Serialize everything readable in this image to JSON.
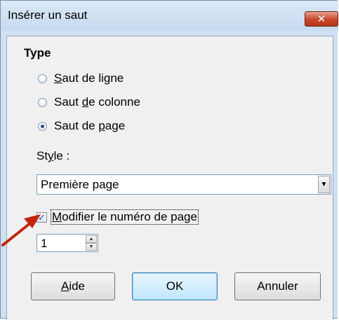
{
  "dialog": {
    "title": "Insérer un saut",
    "close_glyph": "✕"
  },
  "type_section": {
    "title": "Type",
    "options": [
      {
        "pre": "",
        "key": "S",
        "post": "aut de ligne",
        "checked": false
      },
      {
        "pre": "Saut ",
        "key": "d",
        "post": "e colonne",
        "checked": false
      },
      {
        "pre": "Saut de ",
        "key": "p",
        "post": "age",
        "checked": true
      }
    ]
  },
  "style": {
    "label_pre": "St",
    "label_key": "y",
    "label_post": "le :",
    "value": "Première page"
  },
  "page_number": {
    "checkbox_checked": true,
    "checkbox_label_key": "M",
    "checkbox_label_post": "odifier le numéro de page",
    "value": "1"
  },
  "buttons": {
    "help_key": "A",
    "help_post": "ide",
    "ok": "OK",
    "cancel": "Annuler"
  },
  "colors": {
    "annotation_arrow": "#c0250c"
  }
}
